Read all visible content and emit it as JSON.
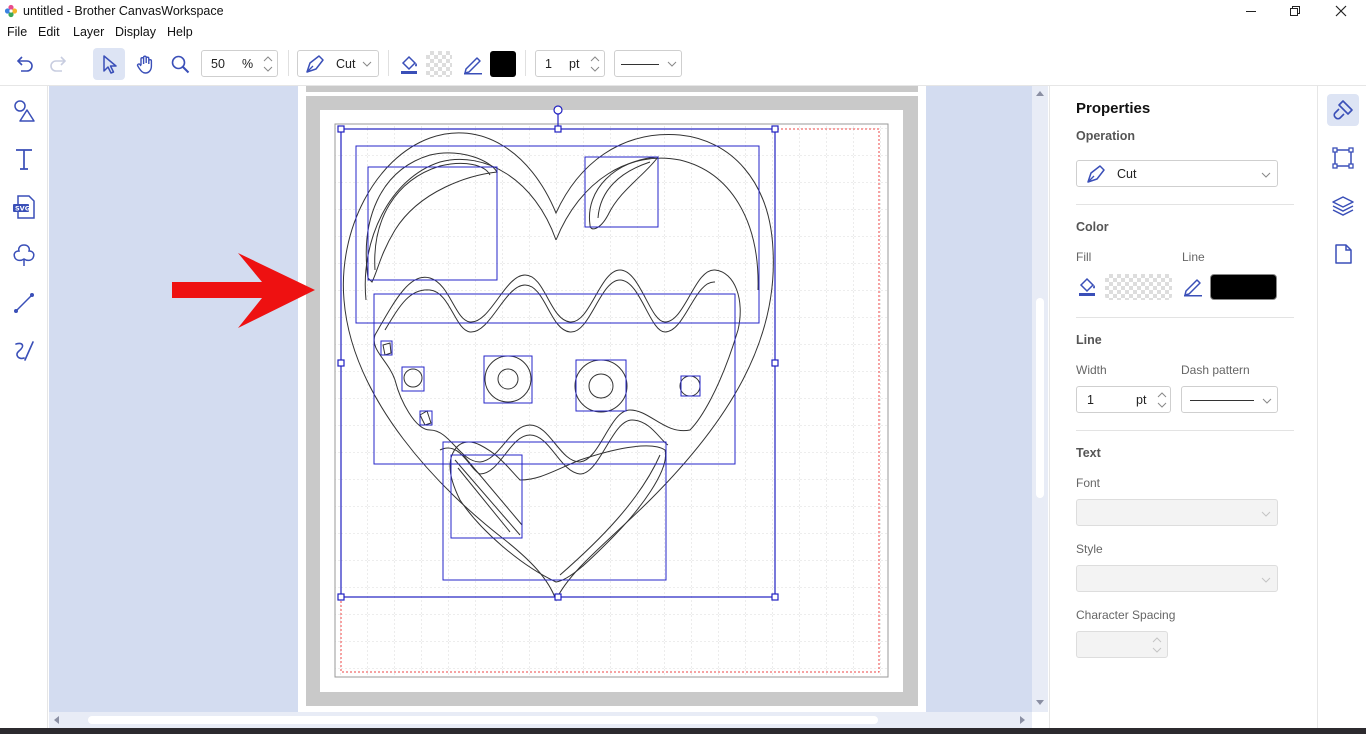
{
  "window": {
    "title": "untitled - Brother CanvasWorkspace",
    "minimize_icon": "minimize-icon",
    "restore_icon": "restore-icon",
    "close_icon": "close-icon"
  },
  "menu": [
    "File",
    "Edit",
    "Layer",
    "Display",
    "Help"
  ],
  "toolbar": {
    "zoom_value": "50",
    "zoom_unit": "%",
    "operation_value": "Cut",
    "line_width_value": "1",
    "line_width_unit": "pt",
    "line_color": "#000000"
  },
  "left_tools": [
    "shapes-icon",
    "text-icon",
    "svg-import-icon",
    "shape-outline-icon",
    "line-icon",
    "freehand-icon"
  ],
  "right_tools": [
    "properties-brush-icon",
    "transform-icon",
    "layers-icon",
    "page-icon"
  ],
  "properties": {
    "title": "Properties",
    "operation_heading": "Operation",
    "operation_value": "Cut",
    "color_heading": "Color",
    "fill_label": "Fill",
    "line_label": "Line",
    "line_color": "#000000",
    "line_heading": "Line",
    "width_label": "Width",
    "width_value": "1",
    "width_unit": "pt",
    "dash_label": "Dash pattern",
    "text_heading": "Text",
    "font_label": "Font",
    "style_label": "Style",
    "spacing_label": "Character Spacing"
  },
  "colors": {
    "accent": "#3a4fb8",
    "canvas_bg": "#d3dcf0",
    "selection": "#2020c0",
    "arrow": "#ee1111"
  }
}
